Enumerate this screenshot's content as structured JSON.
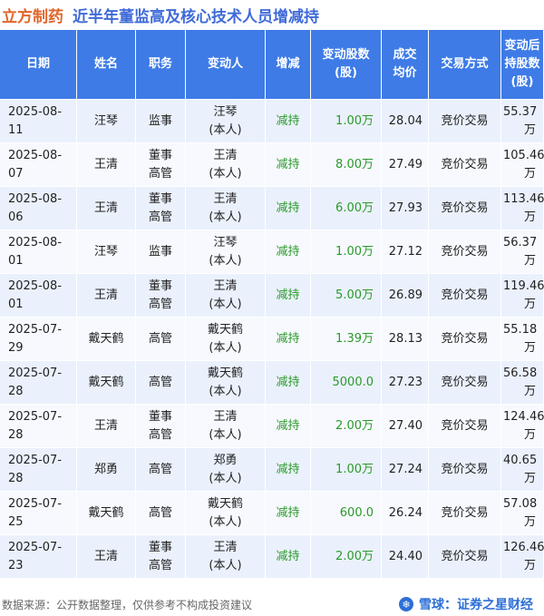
{
  "title": {
    "company": "立方制药",
    "subtitle": "近半年董监高及核心技术人员增减持"
  },
  "columns": [
    "日期",
    "姓名",
    "职务",
    "变动人",
    "增减",
    "变动股数(股)",
    "成交均价",
    "交易方式",
    "变动后持股数(股)"
  ],
  "column_lines": [
    [
      "日期"
    ],
    [
      "姓名"
    ],
    [
      "职务"
    ],
    [
      "变动人"
    ],
    [
      "增减"
    ],
    [
      "变动股数",
      "(股)"
    ],
    [
      "成交",
      "均价"
    ],
    [
      "交易方式"
    ],
    [
      "变动后",
      "持股数",
      "(股)"
    ]
  ],
  "rows": [
    {
      "date": "2025-08-11",
      "name": "汪琴",
      "role": [
        "监事"
      ],
      "changer": [
        "汪琴",
        "(本人)"
      ],
      "action": "减持",
      "shares": "1.00万",
      "price": "28.04",
      "method": "竞价交易",
      "after": "55.37万"
    },
    {
      "date": "2025-08-07",
      "name": "王清",
      "role": [
        "董事",
        "高管"
      ],
      "changer": [
        "王清",
        "(本人)"
      ],
      "action": "减持",
      "shares": "8.00万",
      "price": "27.49",
      "method": "竞价交易",
      "after": "105.46万"
    },
    {
      "date": "2025-08-06",
      "name": "王清",
      "role": [
        "董事",
        "高管"
      ],
      "changer": [
        "王清",
        "(本人)"
      ],
      "action": "减持",
      "shares": "6.00万",
      "price": "27.93",
      "method": "竞价交易",
      "after": "113.46万"
    },
    {
      "date": "2025-08-01",
      "name": "汪琴",
      "role": [
        "监事"
      ],
      "changer": [
        "汪琴",
        "(本人)"
      ],
      "action": "减持",
      "shares": "1.00万",
      "price": "27.12",
      "method": "竞价交易",
      "after": "56.37万"
    },
    {
      "date": "2025-08-01",
      "name": "王清",
      "role": [
        "董事",
        "高管"
      ],
      "changer": [
        "王清",
        "(本人)"
      ],
      "action": "减持",
      "shares": "5.00万",
      "price": "26.89",
      "method": "竞价交易",
      "after": "119.46万"
    },
    {
      "date": "2025-07-29",
      "name": "戴天鹤",
      "role": [
        "高管"
      ],
      "changer": [
        "戴天鹤",
        "(本人)"
      ],
      "action": "减持",
      "shares": "1.39万",
      "price": "28.13",
      "method": "竞价交易",
      "after": "55.18万"
    },
    {
      "date": "2025-07-28",
      "name": "戴天鹤",
      "role": [
        "高管"
      ],
      "changer": [
        "戴天鹤",
        "(本人)"
      ],
      "action": "减持",
      "shares": "5000.0",
      "price": "27.23",
      "method": "竞价交易",
      "after": "56.58万"
    },
    {
      "date": "2025-07-28",
      "name": "王清",
      "role": [
        "董事",
        "高管"
      ],
      "changer": [
        "王清",
        "(本人)"
      ],
      "action": "减持",
      "shares": "2.00万",
      "price": "27.40",
      "method": "竞价交易",
      "after": "124.46万"
    },
    {
      "date": "2025-07-28",
      "name": "郑勇",
      "role": [
        "高管"
      ],
      "changer": [
        "郑勇",
        "(本人)"
      ],
      "action": "减持",
      "shares": "1.00万",
      "price": "27.24",
      "method": "竞价交易",
      "after": "40.65万"
    },
    {
      "date": "2025-07-25",
      "name": "戴天鹤",
      "role": [
        "高管"
      ],
      "changer": [
        "戴天鹤",
        "(本人)"
      ],
      "action": "减持",
      "shares": "600.0",
      "price": "26.24",
      "method": "竞价交易",
      "after": "57.08万"
    },
    {
      "date": "2025-07-23",
      "name": "王清",
      "role": [
        "董事",
        "高管"
      ],
      "changer": [
        "王清",
        "(本人)"
      ],
      "action": "减持",
      "shares": "2.00万",
      "price": "24.40",
      "method": "竞价交易",
      "after": "126.46万"
    }
  ],
  "footer": {
    "source": "数据来源：公开数据整理，仅供参考不构成投资建议",
    "brand": "雪球：证券之星财经",
    "brand_icon": "snowball-icon"
  },
  "watermark": "证券之星",
  "colors": {
    "header_bg": "#3e7be6",
    "title_company": "#e1662a",
    "title_sub": "#3f6ad8",
    "action_green": "#2a9a2a",
    "row_odd": "#eaf1fc",
    "row_even": "#f7f9fe"
  }
}
